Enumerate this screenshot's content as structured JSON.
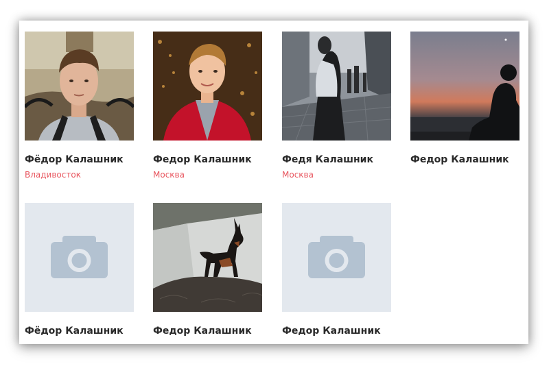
{
  "people": [
    {
      "name": "Фёдор Калашник",
      "city": "Владивосток",
      "photo": "portrait-outdoor"
    },
    {
      "name": "Федор Калашник",
      "city": "Москва",
      "photo": "portrait-red-jacket"
    },
    {
      "name": "Федя Калашник",
      "city": "Москва",
      "photo": "street-hooded"
    },
    {
      "name": "Федор Калашник",
      "city": "",
      "photo": "silhouette-sunset"
    },
    {
      "name": "Фёдор Калашник",
      "city": "",
      "photo": "placeholder-camera-icon"
    },
    {
      "name": "Федор Калашник",
      "city": "",
      "photo": "dog-on-couch"
    },
    {
      "name": "Федор Калашник",
      "city": "",
      "photo": "placeholder-camera-icon"
    }
  ],
  "colors": {
    "city_link": "#e8555e",
    "name_text": "#2a2a2a",
    "placeholder_bg": "#e3e8ee",
    "placeholder_icon": "#b3c2d1"
  }
}
